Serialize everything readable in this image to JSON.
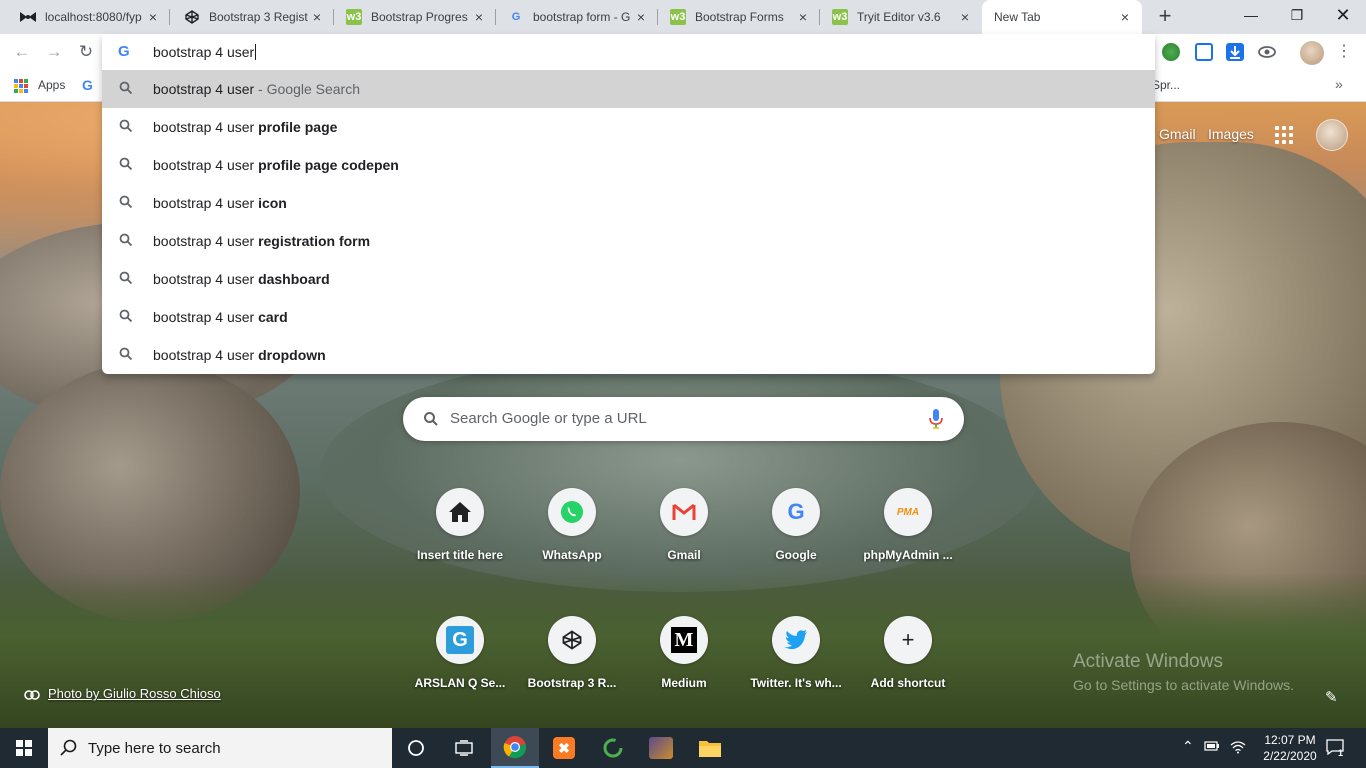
{
  "browser": {
    "tabs": [
      {
        "title": "localhost:8080/fyp",
        "icon": "bow-icon"
      },
      {
        "title": "Bootstrap 3 Regist",
        "icon": "codepen-icon"
      },
      {
        "title": "Bootstrap Progres",
        "icon": "w3schools-icon"
      },
      {
        "title": "bootstrap form - G",
        "icon": "google-icon"
      },
      {
        "title": "Bootstrap Forms",
        "icon": "w3schools-icon"
      },
      {
        "title": "Tryit Editor v3.6",
        "icon": "w3schools-icon"
      },
      {
        "title": "New Tab",
        "icon": "",
        "active": true
      }
    ],
    "new_tab_glyph": "+",
    "bookmarks": {
      "apps_label": "Apps",
      "right_label": "Spr..."
    }
  },
  "omnibox": {
    "input_value": "bootstrap 4 user",
    "suggestions": [
      {
        "prefix": "bootstrap 4 user",
        "bold": "",
        "suffix": " - Google Search",
        "selected": true
      },
      {
        "prefix": "bootstrap 4 user ",
        "bold": "profile page",
        "suffix": ""
      },
      {
        "prefix": "bootstrap 4 user ",
        "bold": "profile page codepen",
        "suffix": ""
      },
      {
        "prefix": "bootstrap 4 user ",
        "bold": "icon",
        "suffix": ""
      },
      {
        "prefix": "bootstrap 4 user ",
        "bold": "registration form",
        "suffix": ""
      },
      {
        "prefix": "bootstrap 4 user ",
        "bold": "dashboard",
        "suffix": ""
      },
      {
        "prefix": "bootstrap 4 user ",
        "bold": "card",
        "suffix": ""
      },
      {
        "prefix": "bootstrap 4 user ",
        "bold": "dropdown",
        "suffix": ""
      }
    ]
  },
  "ntp": {
    "gmail_link": "Gmail",
    "images_link": "Images",
    "search_placeholder": "Search Google or type a URL",
    "tiles_row1": [
      {
        "label": "Insert title here",
        "icon": "house-icon"
      },
      {
        "label": "WhatsApp",
        "icon": "whatsapp-icon"
      },
      {
        "label": "Gmail",
        "icon": "gmail-icon"
      },
      {
        "label": "Google",
        "icon": "google-icon"
      },
      {
        "label": "phpMyAdmin ...",
        "icon": "phpmyadmin-icon"
      }
    ],
    "tiles_row2": [
      {
        "label": "ARSLAN Q Se...",
        "icon": "grammarly-icon"
      },
      {
        "label": "Bootstrap 3 R...",
        "icon": "codepen-icon"
      },
      {
        "label": "Medium",
        "icon": "medium-icon"
      },
      {
        "label": "Twitter. It's wh...",
        "icon": "twitter-icon"
      },
      {
        "label": "Add shortcut",
        "icon": "plus-icon"
      }
    ],
    "photo_credit": "Photo by Giulio Rosso Chioso",
    "activate_title": "Activate Windows",
    "activate_sub": "Go to Settings to activate Windows."
  },
  "taskbar": {
    "search_placeholder": "Type here to search",
    "time": "12:07 PM",
    "date": "2/22/2020",
    "notification_count": "1"
  },
  "colors": {
    "tabstrip_bg": "#dee1e6",
    "selected_suggestion_bg": "#d3d3d3",
    "taskbar_bg": "#1f2a33",
    "google_blue": "#4285f4"
  }
}
